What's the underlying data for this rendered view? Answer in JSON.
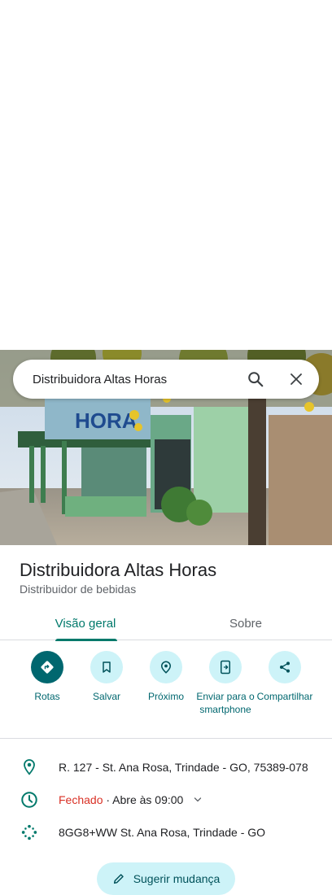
{
  "search": {
    "query": "Distribuidora Altas Horas",
    "search_icon": "search-icon",
    "close_icon": "close-icon"
  },
  "place": {
    "name": "Distribuidora Altas Horas",
    "category": "Distribuidor de bebidas"
  },
  "tabs": [
    {
      "label": "Visão geral",
      "active": true
    },
    {
      "label": "Sobre",
      "active": false
    }
  ],
  "actions": [
    {
      "label": "Rotas",
      "icon": "directions-icon"
    },
    {
      "label": "Salvar",
      "icon": "bookmark-icon"
    },
    {
      "label": "Próximo",
      "icon": "nearby-icon"
    },
    {
      "label": "Enviar para o smartphone",
      "icon": "send-to-phone-icon"
    },
    {
      "label": "Compartilhar",
      "icon": "share-icon"
    }
  ],
  "info": {
    "address": "R. 127 - St. Ana Rosa, Trindade - GO, 75389-078",
    "hours_status": "Fechado",
    "hours_detail": "· Abre às 09:00",
    "plus_code": "8GG8+WW St. Ana Rosa, Trindade - GO"
  },
  "suggest_label": "Sugerir mudança",
  "colors": {
    "accent": "#00796b",
    "button_bg": "#cdf3f8",
    "primary_button": "#00676f",
    "closed": "#d93025"
  }
}
